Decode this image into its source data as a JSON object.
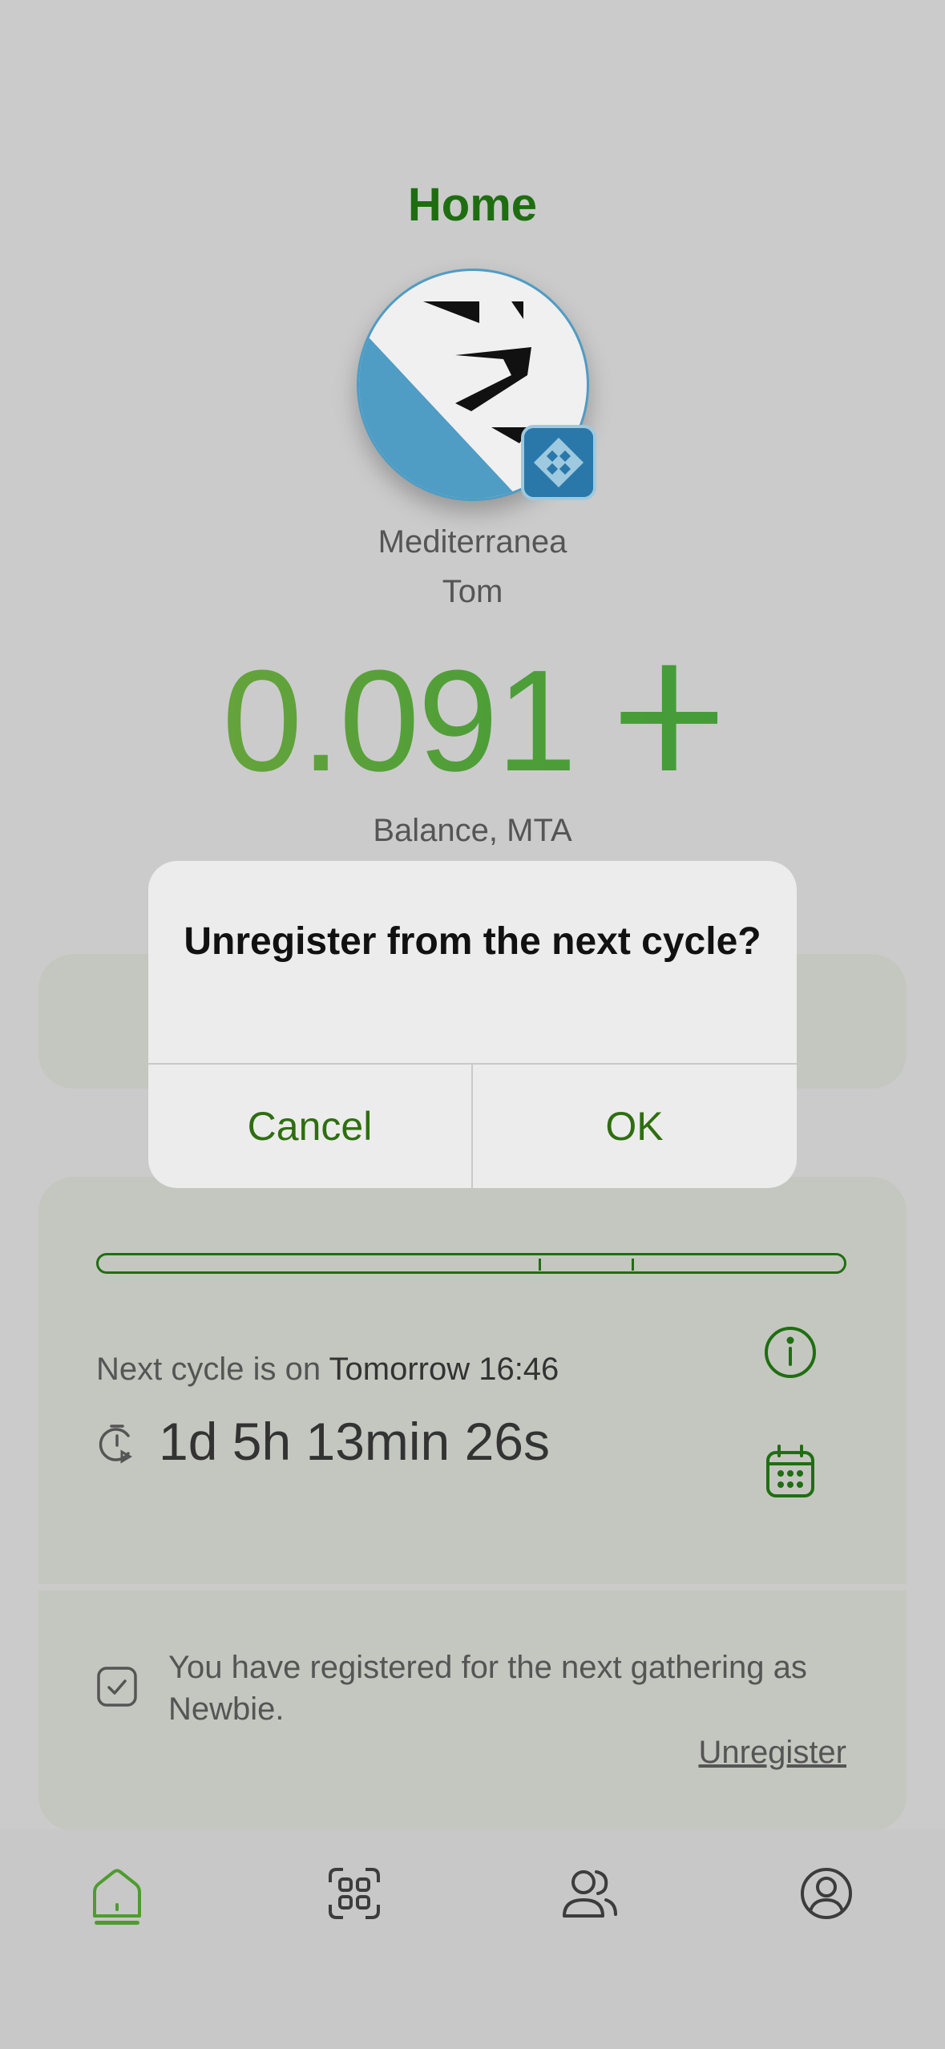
{
  "header": {
    "title": "Home"
  },
  "profile": {
    "community": "Mediterranea",
    "username": "Tom",
    "badge_icon": "community-badge-icon"
  },
  "balance": {
    "amount": "0.091",
    "currency_symbol": "ⵜ",
    "label": "Balance, MTA"
  },
  "cycle": {
    "progress_ticks": [
      0.59,
      0.715
    ],
    "next_cycle_prefix": "Next cycle is on ",
    "next_cycle_time": "Tomorrow 16:46",
    "countdown": "1d 5h 13min 26s"
  },
  "registration": {
    "message": "You have registered for the next gathering as Newbie.",
    "unregister_label": "Unregister"
  },
  "dialog": {
    "title": "Unregister from the next cycle?",
    "cancel_label": "Cancel",
    "ok_label": "OK"
  },
  "nav": {
    "active": "home",
    "items": [
      "home-icon",
      "qr-scan-icon",
      "contacts-icon",
      "profile-icon"
    ]
  },
  "colors": {
    "accent": "#1e6e11",
    "active_nav": "#4e9c2e",
    "background": "#cbcbcb",
    "card": "#c4c7bf"
  }
}
